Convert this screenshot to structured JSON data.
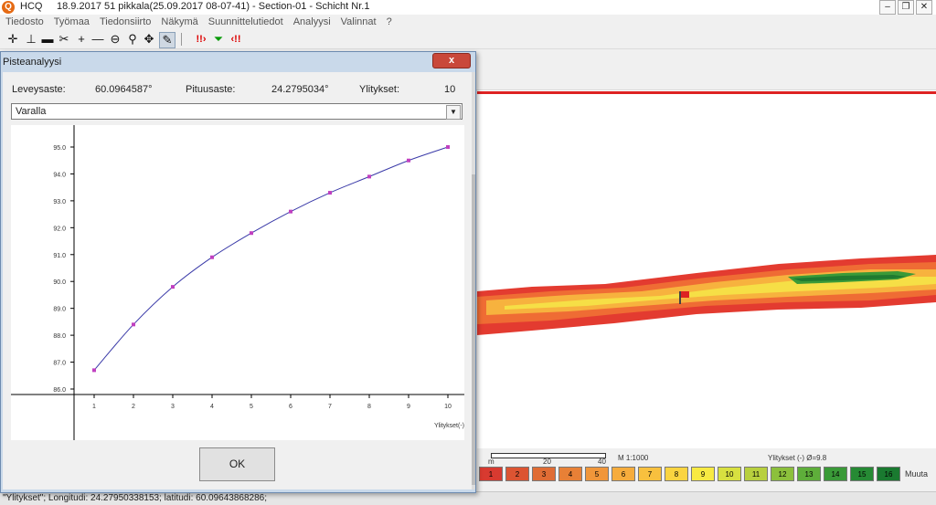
{
  "app": {
    "name": "HCQ",
    "title": "18.9.2017 51 pikkala(25.09.2017 08-07-41) - Section-01 - Schicht Nr.1"
  },
  "menu": [
    "Tiedosto",
    "Työmaa",
    "Tiedonsiirto",
    "Näkymä",
    "Suunnittelutiedot",
    "Analyysi",
    "Valinnat",
    "?"
  ],
  "toolbar_icons": [
    "crosshair-icon",
    "ruler-icon",
    "roller-icon",
    "scissors-icon",
    "plus-icon",
    "minus-icon",
    "zoom-out-icon",
    "zoom-in-icon",
    "pan-icon",
    "pin-icon",
    "warning-arrow-icon",
    "filter-icon",
    "reset-arrow-icon"
  ],
  "dialog": {
    "title": "Pisteanalyysi",
    "close": "x",
    "lat_label": "Leveysaste:",
    "lat_value": "60.0964587°",
    "lon_label": "Pituusaste:",
    "lon_value": "24.2795034°",
    "passes_label": "Ylitykset:",
    "passes_value": "10",
    "select_value": "Varalla",
    "ok": "OK"
  },
  "chart_data": {
    "type": "line",
    "x": [
      1,
      2,
      3,
      4,
      5,
      6,
      7,
      8,
      9,
      10
    ],
    "values": [
      86.7,
      88.4,
      89.8,
      90.9,
      91.8,
      92.6,
      93.3,
      93.9,
      94.5,
      95.0
    ],
    "xlabel": "Ylitykset(-)",
    "ylabel": "",
    "ylim": [
      86.0,
      95.0
    ],
    "yticks": [
      "86.0",
      "87.0",
      "88.0",
      "89.0",
      "90.0",
      "91.0",
      "92.0",
      "93.0",
      "94.0",
      "95.0"
    ],
    "xticks": [
      "1",
      "2",
      "3",
      "4",
      "5",
      "6",
      "7",
      "8",
      "9",
      "10"
    ],
    "line_color": "#3a3aa8",
    "marker_color": "#c040c0",
    "grid": false
  },
  "scale": {
    "m": "m",
    "t20": "20",
    "t40": "40",
    "label": "M 1:1000",
    "passes_avg": "Ylitykset (-) Ø=9.8"
  },
  "legend": {
    "items": [
      {
        "label": "1",
        "color": "#d83a30"
      },
      {
        "label": "2",
        "color": "#dc5432"
      },
      {
        "label": "3",
        "color": "#e06c34"
      },
      {
        "label": "4",
        "color": "#e88036"
      },
      {
        "label": "5",
        "color": "#f0963a"
      },
      {
        "label": "6",
        "color": "#f6ac3c"
      },
      {
        "label": "7",
        "color": "#f8c03e"
      },
      {
        "label": "8",
        "color": "#fad440"
      },
      {
        "label": "9",
        "color": "#f8ea42"
      },
      {
        "label": "10",
        "color": "#d8e040"
      },
      {
        "label": "11",
        "color": "#b8d03e"
      },
      {
        "label": "12",
        "color": "#8cc03c"
      },
      {
        "label": "13",
        "color": "#5eae3a"
      },
      {
        "label": "14",
        "color": "#3a9a38"
      },
      {
        "label": "15",
        "color": "#268a34"
      },
      {
        "label": "16",
        "color": "#1a7a30"
      }
    ],
    "more": "Muuta"
  },
  "status": {
    "text": "\"Ylitykset\"; Longitudi: 24.27950338153; latitudi: 60.09643868286;"
  }
}
